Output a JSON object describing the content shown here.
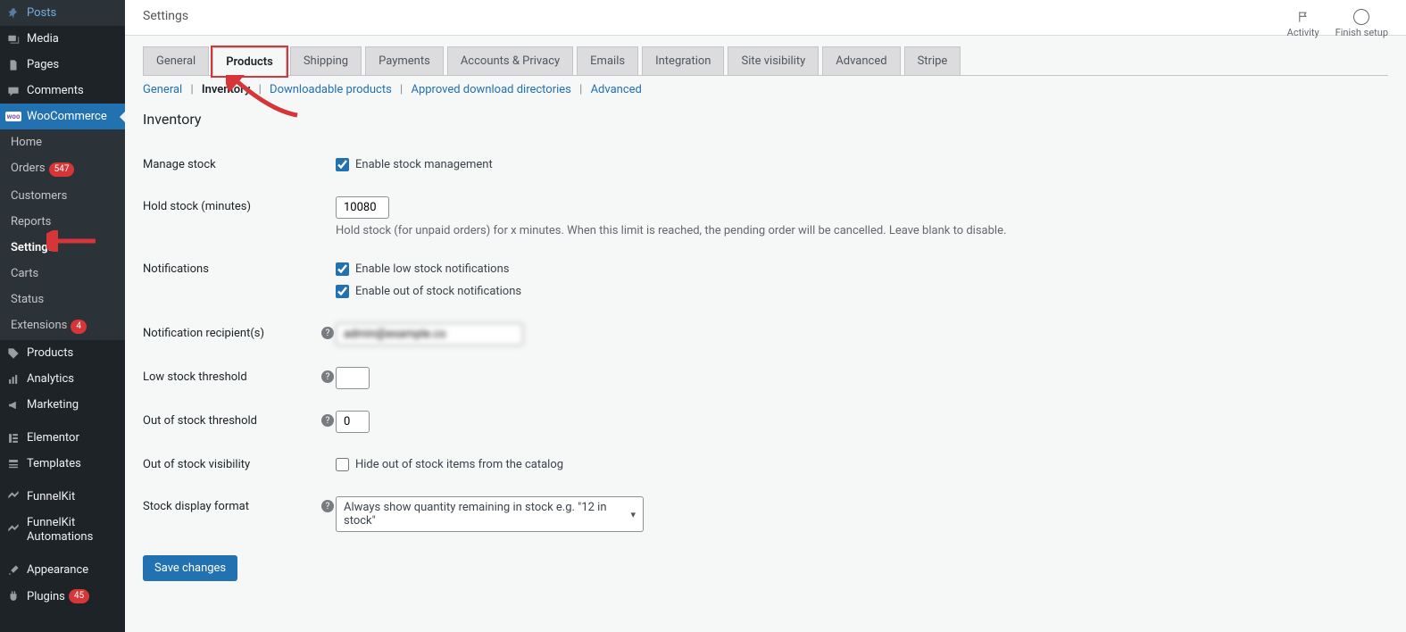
{
  "sidebar": {
    "items": [
      {
        "icon": "pin",
        "label": "Posts"
      },
      {
        "icon": "media",
        "label": "Media"
      },
      {
        "icon": "page",
        "label": "Pages"
      },
      {
        "icon": "comment",
        "label": "Comments"
      },
      {
        "icon": "woo",
        "label": "WooCommerce",
        "active": true
      },
      {
        "icon": "",
        "label": "Home",
        "sub": true
      },
      {
        "icon": "",
        "label": "Orders",
        "sub": true,
        "badge": "547"
      },
      {
        "icon": "",
        "label": "Customers",
        "sub": true
      },
      {
        "icon": "",
        "label": "Reports",
        "sub": true
      },
      {
        "icon": "",
        "label": "Settings",
        "sub": true,
        "current": true
      },
      {
        "icon": "",
        "label": "Carts",
        "sub": true
      },
      {
        "icon": "",
        "label": "Status",
        "sub": true
      },
      {
        "icon": "",
        "label": "Extensions",
        "sub": true,
        "badge": "4"
      },
      {
        "icon": "tag",
        "label": "Products"
      },
      {
        "icon": "chart",
        "label": "Analytics"
      },
      {
        "icon": "mega",
        "label": "Marketing"
      },
      {
        "icon": "ele",
        "label": "Elementor"
      },
      {
        "icon": "tmpl",
        "label": "Templates"
      },
      {
        "icon": "fk",
        "label": "FunnelKit"
      },
      {
        "icon": "fk",
        "label": "FunnelKit Automations"
      },
      {
        "icon": "brush",
        "label": "Appearance"
      },
      {
        "icon": "plug",
        "label": "Plugins",
        "badge": "45"
      }
    ]
  },
  "topbar": {
    "title": "Settings",
    "activity": "Activity",
    "finish": "Finish setup"
  },
  "tabs": [
    "General",
    "Products",
    "Shipping",
    "Payments",
    "Accounts & Privacy",
    "Emails",
    "Integration",
    "Site visibility",
    "Advanced",
    "Stripe"
  ],
  "tabs_active_index": 1,
  "subtabs": {
    "general": "General",
    "inventory": "Inventory",
    "downloadable": "Downloadable products",
    "approved": "Approved download directories",
    "advanced": "Advanced"
  },
  "section": {
    "title": "Inventory",
    "manage_stock": {
      "label": "Manage stock",
      "cb": "Enable stock management"
    },
    "hold_stock": {
      "label": "Hold stock (minutes)",
      "value": "10080",
      "desc": "Hold stock (for unpaid orders) for x minutes. When this limit is reached, the pending order will be cancelled. Leave blank to disable."
    },
    "notifications": {
      "label": "Notifications",
      "cb1": "Enable low stock notifications",
      "cb2": "Enable out of stock notifications"
    },
    "recipients": {
      "label": "Notification recipient(s)",
      "value": "admin@example.co"
    },
    "low_thresh": {
      "label": "Low stock threshold",
      "value": ""
    },
    "oos_thresh": {
      "label": "Out of stock threshold",
      "value": "0"
    },
    "oos_vis": {
      "label": "Out of stock visibility",
      "cb": "Hide out of stock items from the catalog"
    },
    "display": {
      "label": "Stock display format",
      "value": "Always show quantity remaining in stock e.g. \"12 in stock\""
    },
    "save": "Save changes"
  }
}
